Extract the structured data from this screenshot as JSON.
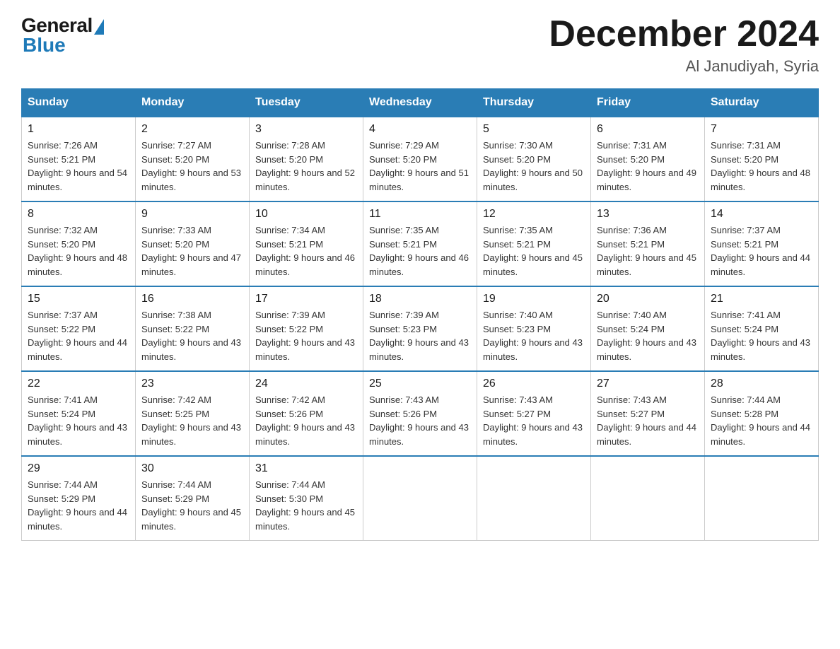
{
  "header": {
    "logo_general": "General",
    "logo_blue": "Blue",
    "month_title": "December 2024",
    "location": "Al Janudiyah, Syria"
  },
  "days_of_week": [
    "Sunday",
    "Monday",
    "Tuesday",
    "Wednesday",
    "Thursday",
    "Friday",
    "Saturday"
  ],
  "weeks": [
    [
      {
        "day": "1",
        "sunrise": "7:26 AM",
        "sunset": "5:21 PM",
        "daylight": "9 hours and 54 minutes."
      },
      {
        "day": "2",
        "sunrise": "7:27 AM",
        "sunset": "5:20 PM",
        "daylight": "9 hours and 53 minutes."
      },
      {
        "day": "3",
        "sunrise": "7:28 AM",
        "sunset": "5:20 PM",
        "daylight": "9 hours and 52 minutes."
      },
      {
        "day": "4",
        "sunrise": "7:29 AM",
        "sunset": "5:20 PM",
        "daylight": "9 hours and 51 minutes."
      },
      {
        "day": "5",
        "sunrise": "7:30 AM",
        "sunset": "5:20 PM",
        "daylight": "9 hours and 50 minutes."
      },
      {
        "day": "6",
        "sunrise": "7:31 AM",
        "sunset": "5:20 PM",
        "daylight": "9 hours and 49 minutes."
      },
      {
        "day": "7",
        "sunrise": "7:31 AM",
        "sunset": "5:20 PM",
        "daylight": "9 hours and 48 minutes."
      }
    ],
    [
      {
        "day": "8",
        "sunrise": "7:32 AM",
        "sunset": "5:20 PM",
        "daylight": "9 hours and 48 minutes."
      },
      {
        "day": "9",
        "sunrise": "7:33 AM",
        "sunset": "5:20 PM",
        "daylight": "9 hours and 47 minutes."
      },
      {
        "day": "10",
        "sunrise": "7:34 AM",
        "sunset": "5:21 PM",
        "daylight": "9 hours and 46 minutes."
      },
      {
        "day": "11",
        "sunrise": "7:35 AM",
        "sunset": "5:21 PM",
        "daylight": "9 hours and 46 minutes."
      },
      {
        "day": "12",
        "sunrise": "7:35 AM",
        "sunset": "5:21 PM",
        "daylight": "9 hours and 45 minutes."
      },
      {
        "day": "13",
        "sunrise": "7:36 AM",
        "sunset": "5:21 PM",
        "daylight": "9 hours and 45 minutes."
      },
      {
        "day": "14",
        "sunrise": "7:37 AM",
        "sunset": "5:21 PM",
        "daylight": "9 hours and 44 minutes."
      }
    ],
    [
      {
        "day": "15",
        "sunrise": "7:37 AM",
        "sunset": "5:22 PM",
        "daylight": "9 hours and 44 minutes."
      },
      {
        "day": "16",
        "sunrise": "7:38 AM",
        "sunset": "5:22 PM",
        "daylight": "9 hours and 43 minutes."
      },
      {
        "day": "17",
        "sunrise": "7:39 AM",
        "sunset": "5:22 PM",
        "daylight": "9 hours and 43 minutes."
      },
      {
        "day": "18",
        "sunrise": "7:39 AM",
        "sunset": "5:23 PM",
        "daylight": "9 hours and 43 minutes."
      },
      {
        "day": "19",
        "sunrise": "7:40 AM",
        "sunset": "5:23 PM",
        "daylight": "9 hours and 43 minutes."
      },
      {
        "day": "20",
        "sunrise": "7:40 AM",
        "sunset": "5:24 PM",
        "daylight": "9 hours and 43 minutes."
      },
      {
        "day": "21",
        "sunrise": "7:41 AM",
        "sunset": "5:24 PM",
        "daylight": "9 hours and 43 minutes."
      }
    ],
    [
      {
        "day": "22",
        "sunrise": "7:41 AM",
        "sunset": "5:24 PM",
        "daylight": "9 hours and 43 minutes."
      },
      {
        "day": "23",
        "sunrise": "7:42 AM",
        "sunset": "5:25 PM",
        "daylight": "9 hours and 43 minutes."
      },
      {
        "day": "24",
        "sunrise": "7:42 AM",
        "sunset": "5:26 PM",
        "daylight": "9 hours and 43 minutes."
      },
      {
        "day": "25",
        "sunrise": "7:43 AM",
        "sunset": "5:26 PM",
        "daylight": "9 hours and 43 minutes."
      },
      {
        "day": "26",
        "sunrise": "7:43 AM",
        "sunset": "5:27 PM",
        "daylight": "9 hours and 43 minutes."
      },
      {
        "day": "27",
        "sunrise": "7:43 AM",
        "sunset": "5:27 PM",
        "daylight": "9 hours and 44 minutes."
      },
      {
        "day": "28",
        "sunrise": "7:44 AM",
        "sunset": "5:28 PM",
        "daylight": "9 hours and 44 minutes."
      }
    ],
    [
      {
        "day": "29",
        "sunrise": "7:44 AM",
        "sunset": "5:29 PM",
        "daylight": "9 hours and 44 minutes."
      },
      {
        "day": "30",
        "sunrise": "7:44 AM",
        "sunset": "5:29 PM",
        "daylight": "9 hours and 45 minutes."
      },
      {
        "day": "31",
        "sunrise": "7:44 AM",
        "sunset": "5:30 PM",
        "daylight": "9 hours and 45 minutes."
      },
      null,
      null,
      null,
      null
    ]
  ]
}
